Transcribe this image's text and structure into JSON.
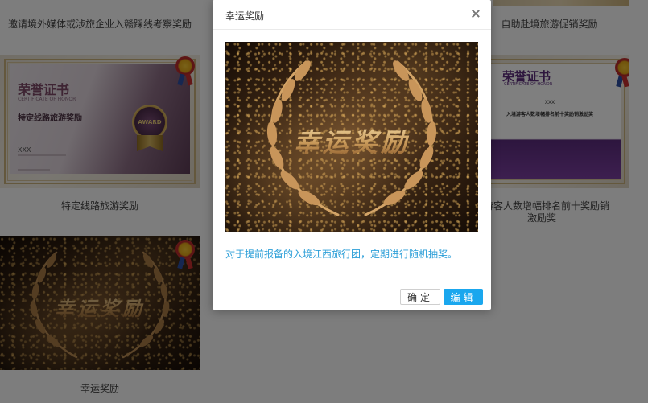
{
  "cards": {
    "top_left_title": "邀请境外媒体或涉旅企业入赣踩线考察奖励",
    "top_right_title": "自助赴境旅游促销奖励",
    "mid_left": {
      "title": "特定线路旅游奖励",
      "cert_heading": "荣誉证书",
      "cert_subheading": "CERTIFICATE OF HONOR",
      "cert_name": "特定线路旅游奖励",
      "cert_holder": "XXX",
      "seal_text": "AWARD"
    },
    "mid_right": {
      "title": "旅游客人数增幅排名前十奖励销激励奖",
      "cert_heading": "荣誉证书",
      "cert_subheading": "CERTIFICATE OF HONOR",
      "cert_holder": "XXX",
      "cert_line": "入境游客人数增幅排名前十奖励销激励奖"
    },
    "bottom_left": {
      "title": "幸运奖励",
      "art_text": "幸运奖励"
    }
  },
  "modal": {
    "title": "幸运奖励",
    "art_text": "幸运奖励",
    "description": "对于提前报备的入境江西旅行团，定期进行随机抽奖。",
    "ok_label": "确定",
    "edit_label": "编辑"
  },
  "colors": {
    "overlay": "rgba(0,0,0,0.5)",
    "description_text": "#2d9fd8",
    "primary_button": "#1aa7ee"
  }
}
